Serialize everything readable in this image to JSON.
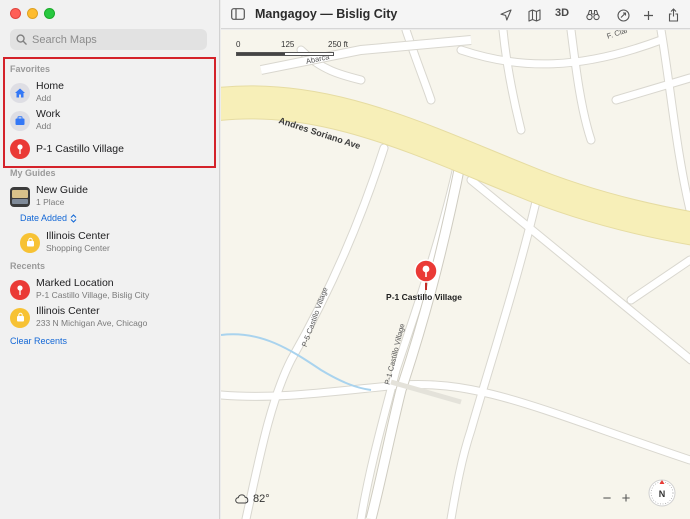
{
  "window": {
    "title": "Mangagoy — Bislig City"
  },
  "search": {
    "placeholder": "Search Maps",
    "icon": "magnifier-icon"
  },
  "sidebar": {
    "favorites": {
      "heading": "Favorites",
      "items": [
        {
          "title": "Home",
          "subtitle": "Add",
          "icon": "house-icon"
        },
        {
          "title": "Work",
          "subtitle": "Add",
          "icon": "briefcase-icon"
        },
        {
          "title": "P-1 Castillo Village",
          "subtitle": "",
          "icon": "pin-icon"
        }
      ]
    },
    "guides": {
      "heading": "My Guides",
      "guide": {
        "title": "New Guide",
        "subtitle": "1 Place"
      },
      "sort_label": "Date Added",
      "places": [
        {
          "title": "Illinois Center",
          "subtitle": "Shopping Center",
          "icon": "bag-icon"
        }
      ]
    },
    "recents": {
      "heading": "Recents",
      "items": [
        {
          "title": "Marked Location",
          "subtitle": "P-1 Castillo Village, Bislig City",
          "icon": "pin-icon"
        },
        {
          "title": "Illinois Center",
          "subtitle": "233 N Michigan Ave, Chicago",
          "icon": "bag-icon"
        }
      ],
      "clear_label": "Clear Recents"
    }
  },
  "toolbar": {
    "three_d_label": "3D",
    "buttons": [
      "sidebar-toggle-icon",
      "location-arrow-icon",
      "map-mode-icon",
      "3d-toggle",
      "binoculars-icon",
      "account-icon",
      "plus-icon",
      "share-icon"
    ]
  },
  "map": {
    "scale_labels": [
      "0",
      "125",
      "250 ft"
    ],
    "streets": {
      "andres": "Andres Soriano Ave",
      "abarca": "Abarca",
      "f_clar": "F. Clar",
      "p5": "P-5 Castillo Village",
      "p1": "P-1 Castillo Village"
    },
    "pin_label": "P-1 Castillo Village",
    "weather": "82°",
    "zoom_out": "−",
    "zoom_in": "+",
    "compass_label": "N"
  },
  "colors": {
    "accent_red": "#ea3a36",
    "highlight_border": "#d4222a",
    "link_blue": "#1468d6",
    "major_road": "#f7efb8",
    "map_bg": "#f7f5ec",
    "water": "#a9d3ee"
  }
}
